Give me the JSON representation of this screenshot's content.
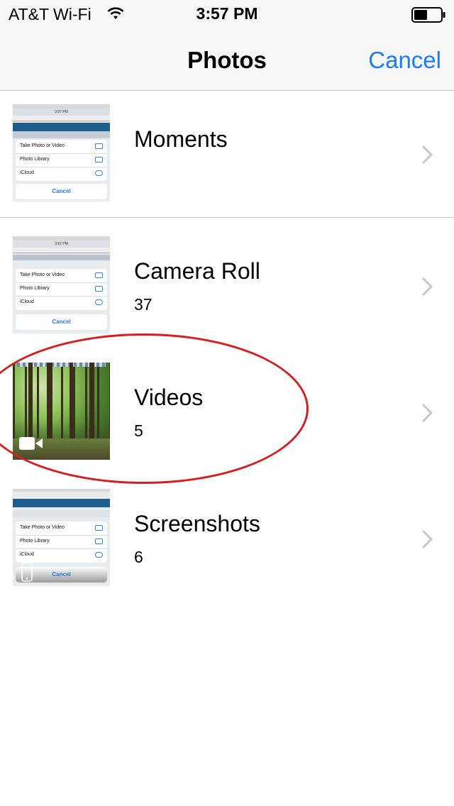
{
  "status_bar": {
    "carrier": "AT&T Wi-Fi",
    "time": "3:57 PM",
    "icons": [
      "wifi-icon",
      "battery-icon"
    ]
  },
  "nav": {
    "title": "Photos",
    "cancel_label": "Cancel"
  },
  "thumbnail_sheet": {
    "time": "3:57 PM",
    "options": [
      "Take Photo or Video",
      "Photo Library",
      "iCloud"
    ],
    "cancel": "Cancel"
  },
  "albums": [
    {
      "title": "Moments",
      "count": ""
    },
    {
      "title": "Camera Roll",
      "count": "37"
    },
    {
      "title": "Videos",
      "count": "5"
    },
    {
      "title": "Screenshots",
      "count": "6"
    }
  ],
  "colors": {
    "accent": "#1a7ff2",
    "separator": "#c8c7cc",
    "highlight_oval": "#d21f1f"
  }
}
